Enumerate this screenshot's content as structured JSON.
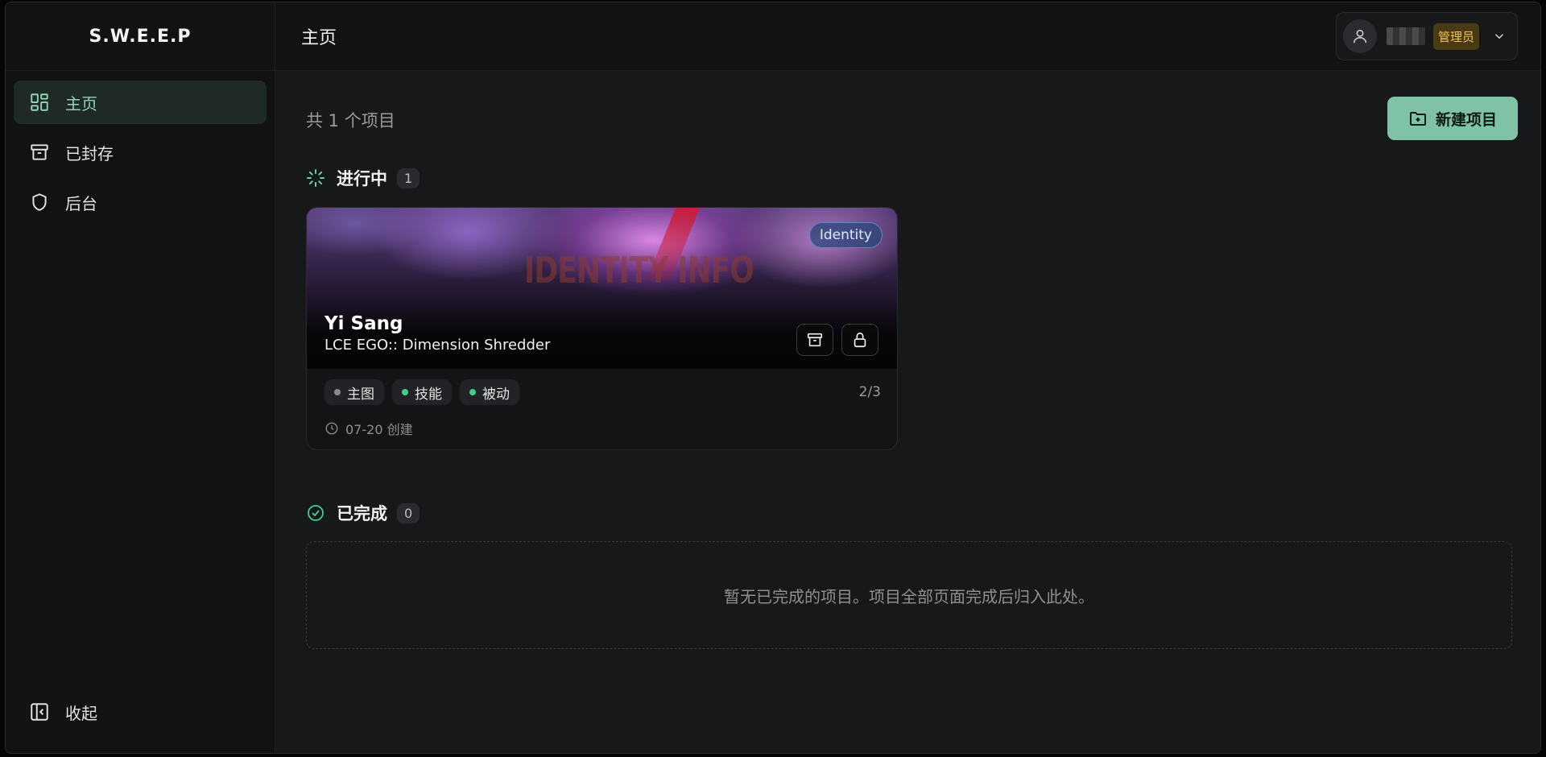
{
  "app": {
    "brand": "S.W.E.E.P"
  },
  "sidebar": {
    "items": [
      {
        "label": "主页",
        "icon": "dashboard-grid-icon",
        "active": true
      },
      {
        "label": "已封存",
        "icon": "archive-icon",
        "active": false
      },
      {
        "label": "后台",
        "icon": "shield-icon",
        "active": false
      }
    ],
    "collapse_label": "收起"
  },
  "header": {
    "title": "主页",
    "user": {
      "role_badge": "管理员"
    }
  },
  "main": {
    "project_count_text": "共 1 个项目",
    "new_button_label": "新建项目",
    "in_progress": {
      "title": "进行中",
      "count": "1",
      "cards": [
        {
          "badge": "Identity",
          "name": "Yi Sang",
          "ego": "LCE EGO:: Dimension Shredder",
          "tags": [
            {
              "label": "主图",
              "status_color": "#8a8b8f"
            },
            {
              "label": "技能",
              "status_color": "#3fd08f"
            },
            {
              "label": "被动",
              "status_color": "#3fd08f"
            }
          ],
          "progress": "2/3",
          "created": "07-20 创建"
        }
      ]
    },
    "completed": {
      "title": "已完成",
      "count": "0",
      "empty_text": "暂无已完成的项目。项目全部页面完成后归入此处。"
    }
  },
  "colors": {
    "accent": "#7fc2a5",
    "active_nav_text": "#8fd3b5",
    "role_badge_bg": "#4a3a12",
    "role_badge_text": "#f1c352"
  }
}
